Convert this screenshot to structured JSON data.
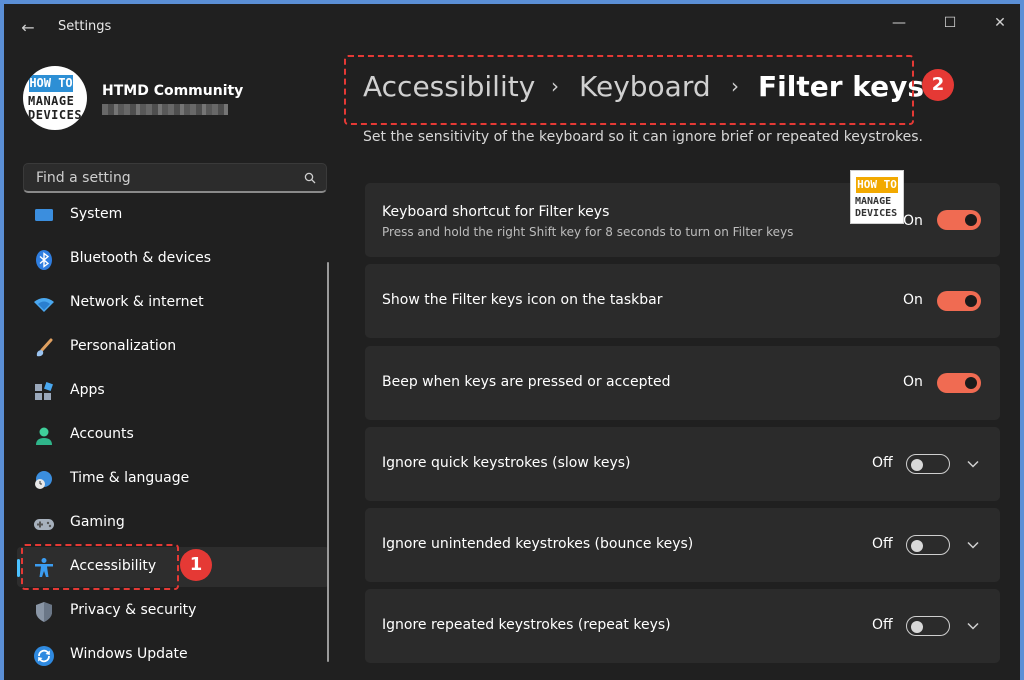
{
  "window": {
    "title": "Settings"
  },
  "profile": {
    "name": "HTMD Community",
    "avatar_line1": "HOW TO",
    "avatar_line2": "MANAGE",
    "avatar_line3": "DEVICES"
  },
  "search": {
    "placeholder": "Find a setting"
  },
  "nav": {
    "items": [
      {
        "label": "System",
        "icon": "system-icon"
      },
      {
        "label": "Bluetooth & devices",
        "icon": "bluetooth-icon"
      },
      {
        "label": "Network & internet",
        "icon": "wifi-icon"
      },
      {
        "label": "Personalization",
        "icon": "brush-icon"
      },
      {
        "label": "Apps",
        "icon": "apps-icon"
      },
      {
        "label": "Accounts",
        "icon": "person-icon"
      },
      {
        "label": "Time & language",
        "icon": "globe-clock-icon"
      },
      {
        "label": "Gaming",
        "icon": "gamepad-icon"
      },
      {
        "label": "Accessibility",
        "icon": "accessibility-icon",
        "active": true
      },
      {
        "label": "Privacy & security",
        "icon": "shield-icon"
      },
      {
        "label": "Windows Update",
        "icon": "update-icon"
      }
    ]
  },
  "annotations": {
    "badge1": "1",
    "badge2": "2"
  },
  "breadcrumb": {
    "parts": [
      "Accessibility",
      "Keyboard",
      "Filter keys"
    ]
  },
  "page": {
    "description": "Set the sensitivity of the keyboard so it can ignore brief or repeated keystrokes."
  },
  "watermark": {
    "line1": "HOW TO",
    "line2": "MANAGE",
    "line3": "DEVICES"
  },
  "settings": [
    {
      "title": "Keyboard shortcut for Filter keys",
      "subtitle": "Press and hold the right Shift key for 8 seconds to turn on Filter keys",
      "state": "On",
      "on": true,
      "expandable": false
    },
    {
      "title": "Show the Filter keys icon on the taskbar",
      "state": "On",
      "on": true,
      "expandable": false
    },
    {
      "title": "Beep when keys are pressed or accepted",
      "state": "On",
      "on": true,
      "expandable": false
    },
    {
      "title": "Ignore quick keystrokes (slow keys)",
      "state": "Off",
      "on": false,
      "expandable": true
    },
    {
      "title": "Ignore unintended keystrokes (bounce keys)",
      "state": "Off",
      "on": false,
      "expandable": true
    },
    {
      "title": "Ignore repeated keystrokes (repeat keys)",
      "state": "Off",
      "on": false,
      "expandable": true
    }
  ],
  "colors": {
    "accent": "#f06b52",
    "annotation": "#e53935",
    "background": "#202020",
    "card": "#2b2b2b"
  }
}
